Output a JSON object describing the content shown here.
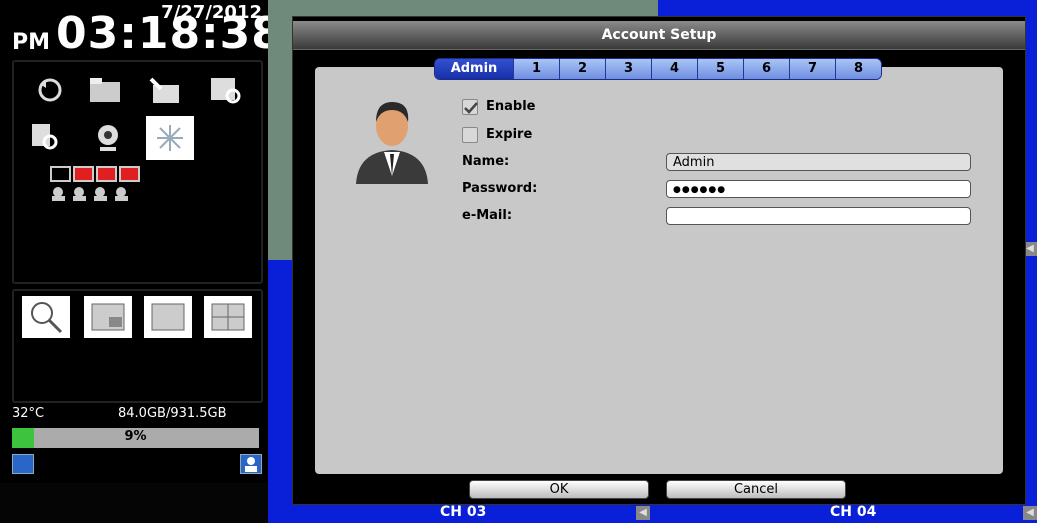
{
  "clock": {
    "date": "7/27/2012",
    "ampm": "PM",
    "time": "03:18:38"
  },
  "status": {
    "temperature": "32°C",
    "disk": "84.0GB/931.5GB",
    "usage_label": "9%",
    "usage_fraction": 0.09
  },
  "cameras": {
    "ch3_label": "CH 03",
    "ch4_label": "CH 04"
  },
  "dialog": {
    "title": "Account Setup",
    "tabs": [
      "Admin",
      "1",
      "2",
      "3",
      "4",
      "5",
      "6",
      "7",
      "8"
    ],
    "active_tab": "Admin",
    "enable_label": "Enable",
    "expire_label": "Expire",
    "name_label": "Name:",
    "name_value": "Admin",
    "password_label": "Password:",
    "password_value": "●●●●●●",
    "email_label": "e-Mail:",
    "email_value": "",
    "ok_label": "OK",
    "cancel_label": "Cancel"
  }
}
